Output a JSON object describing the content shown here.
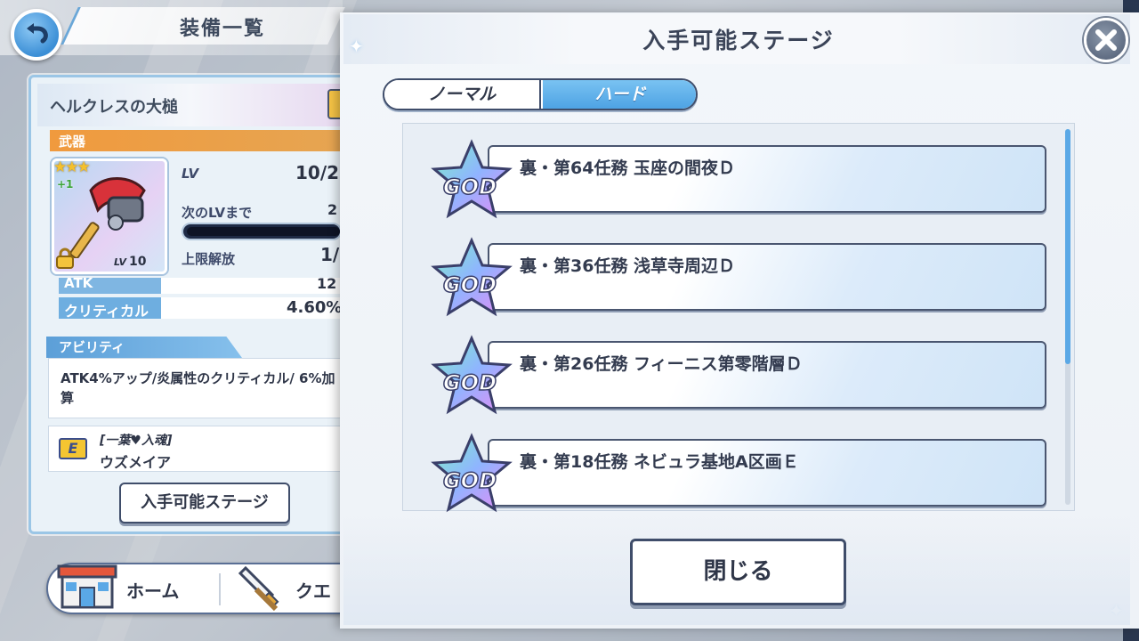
{
  "colors": {
    "accent_blue": "#4ea3e4",
    "category_orange": "#f09a3e",
    "outline_navy": "#3f4d6a",
    "star_gold": "#f5c02c"
  },
  "header": {
    "back_icon": "back-arrow-icon",
    "title": "装備一覧"
  },
  "equipment": {
    "name": "ヘルクレスの大槌",
    "category": "武器",
    "stars": "★★★",
    "plus": "+1",
    "lv_badge_label": "LV",
    "lv_badge_value": "10",
    "lv_label": "LV",
    "lv_value": "10/2",
    "next_lv_label": "次のLVまで",
    "next_lv_value": "2",
    "limit_label": "上限解放",
    "limit_value": "1/",
    "atk_label": "ATK",
    "atk_value": "12",
    "crit_label": "クリティカル",
    "crit_value": "4.60%",
    "ability_tag": "アビリティ",
    "ability_text": "ATK4%アップ/炎属性のクリティカル/ 6%加算",
    "rank": "E",
    "character_title": "[一葉♥入魂]",
    "character_name": "ウズメイア",
    "source_button": "入手可能ステージ"
  },
  "nav": {
    "home_label": "ホーム",
    "quest_label": "クエ"
  },
  "modal": {
    "title": "入手可能ステージ",
    "close_icon": "close-icon",
    "tabs": [
      {
        "label": "ノーマル",
        "active": false
      },
      {
        "label": "ハード",
        "active": true
      }
    ],
    "stages": [
      {
        "badge": "GOD",
        "label": "裏・第64任務 玉座の間夜Ｄ"
      },
      {
        "badge": "GOD",
        "label": "裏・第36任務 浅草寺周辺Ｄ"
      },
      {
        "badge": "GOD",
        "label": "裏・第26任務 フィーニス第零階層Ｄ"
      },
      {
        "badge": "GOD",
        "label": "裏・第18任務 ネビュラ基地A区画Ｅ"
      }
    ],
    "close_button": "閉じる"
  }
}
